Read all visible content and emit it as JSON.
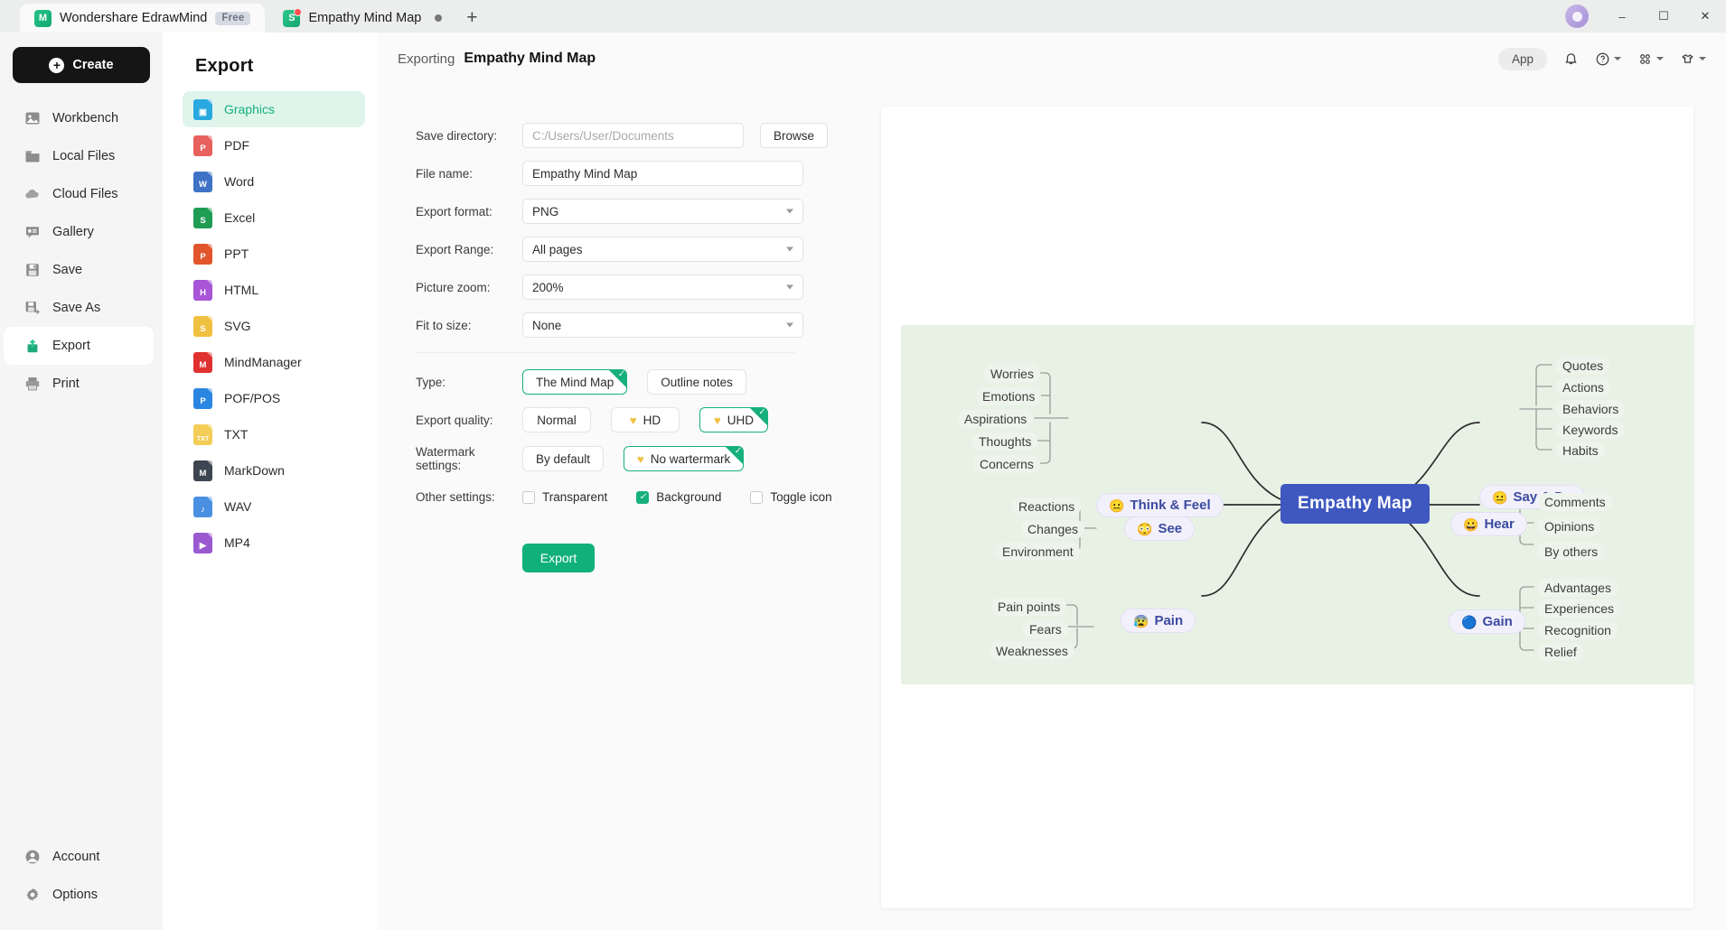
{
  "titlebar": {
    "app_tab": {
      "label": "Wondershare EdrawMind",
      "badge": "Free",
      "icon": "edrawmind-logo-icon"
    },
    "doc_tab": {
      "label": "Empathy Mind Map",
      "icon": "mindmap-doc-icon"
    },
    "new_tab_label": "+",
    "window": {
      "minimize": "–",
      "maximize": "☐",
      "close": "✕"
    }
  },
  "leftnav": {
    "create_label": "Create",
    "items": [
      {
        "label": "Workbench",
        "icon": "workbench-icon"
      },
      {
        "label": "Local Files",
        "icon": "folder-icon"
      },
      {
        "label": "Cloud Files",
        "icon": "cloud-icon"
      },
      {
        "label": "Gallery",
        "icon": "gallery-icon"
      },
      {
        "label": "Save",
        "icon": "save-icon"
      },
      {
        "label": "Save As",
        "icon": "save-as-icon"
      },
      {
        "label": "Export",
        "icon": "export-icon"
      },
      {
        "label": "Print",
        "icon": "print-icon"
      }
    ],
    "active": "Export",
    "bottom": [
      {
        "label": "Account",
        "icon": "account-icon"
      },
      {
        "label": "Options",
        "icon": "gear-icon"
      }
    ]
  },
  "format_panel": {
    "title": "Export",
    "active": "Graphics",
    "items": [
      {
        "label": "Graphics",
        "letter": "▣",
        "color": "#2aa9e0"
      },
      {
        "label": "PDF",
        "letter": "P",
        "color": "#e8615e"
      },
      {
        "label": "Word",
        "letter": "W",
        "color": "#3f72c4"
      },
      {
        "label": "Excel",
        "letter": "S",
        "color": "#1f9d55"
      },
      {
        "label": "PPT",
        "letter": "P",
        "color": "#e2552c"
      },
      {
        "label": "HTML",
        "letter": "H",
        "color": "#a855d8"
      },
      {
        "label": "SVG",
        "letter": "S",
        "color": "#f0c040"
      },
      {
        "label": "MindManager",
        "letter": "M",
        "color": "#e03131"
      },
      {
        "label": "POF/POS",
        "letter": "P",
        "color": "#2a86e0"
      },
      {
        "label": "TXT",
        "letter": "TXT",
        "color": "#f3cd58"
      },
      {
        "label": "MarkDown",
        "letter": "M",
        "color": "#3c4550"
      },
      {
        "label": "WAV",
        "letter": "♪",
        "color": "#4a90e2"
      },
      {
        "label": "MP4",
        "letter": "▶",
        "color": "#9b59d0"
      }
    ]
  },
  "topbar": {
    "breadcrumb_prefix": "Exporting",
    "document_title": "Empathy Mind Map",
    "app_pill": "App",
    "icons": [
      "bell-icon",
      "help-icon",
      "apps-grid-icon",
      "theme-shirt-icon"
    ]
  },
  "form": {
    "save_directory": {
      "label": "Save directory:",
      "placeholder": "C:/Users/User/Documents",
      "value": ""
    },
    "browse_label": "Browse",
    "file_name": {
      "label": "File name:",
      "value": "Empathy Mind Map"
    },
    "export_format": {
      "label": "Export format:",
      "value": "PNG"
    },
    "export_range": {
      "label": "Export Range:",
      "value": "All pages"
    },
    "picture_zoom": {
      "label": "Picture zoom:",
      "value": "200%"
    },
    "fit_to_size": {
      "label": "Fit to size:",
      "value": "None"
    },
    "type": {
      "label": "Type:",
      "options": [
        "The Mind Map",
        "Outline notes"
      ],
      "selected": "The Mind Map"
    },
    "export_quality": {
      "label": "Export quality:",
      "options": [
        "Normal",
        "HD",
        "UHD"
      ],
      "selected": "UHD"
    },
    "watermark": {
      "label": "Watermark settings:",
      "options": [
        "By default",
        "No wartermark"
      ],
      "selected": "No wartermark"
    },
    "other_settings": {
      "label": "Other settings:",
      "checkboxes": [
        {
          "label": "Transparent",
          "checked": false
        },
        {
          "label": "Background",
          "checked": true
        },
        {
          "label": "Toggle icon",
          "checked": false
        }
      ]
    },
    "export_button": "Export"
  },
  "mindmap": {
    "root": "Empathy Map",
    "branches": [
      {
        "title": "Think & Feel",
        "emoji": "😐",
        "side": "left",
        "children": [
          "Worries",
          "Emotions",
          "Aspirations",
          "Thoughts",
          "Concerns"
        ]
      },
      {
        "title": "Say & Do",
        "emoji": "😐",
        "side": "right",
        "children": [
          "Quotes",
          "Actions",
          "Behaviors",
          "Keywords",
          "Habits"
        ]
      },
      {
        "title": "See",
        "emoji": "😳",
        "side": "left",
        "children": [
          "Reactions",
          "Changes",
          "Environment"
        ]
      },
      {
        "title": "Hear",
        "emoji": "😀",
        "side": "right",
        "children": [
          "Comments",
          "Opinions",
          "By others"
        ]
      },
      {
        "title": "Pain",
        "emoji": "😰",
        "side": "left",
        "children": [
          "Pain points",
          "Fears",
          "Weaknesses"
        ]
      },
      {
        "title": "Gain",
        "emoji": "🔵",
        "side": "right",
        "children": [
          "Advantages",
          "Experiences",
          "Recognition",
          "Relief"
        ]
      }
    ]
  },
  "colors": {
    "accent_green": "#16b07b",
    "root_blue": "#3f58c0",
    "canvas_green": "#e8f2e4",
    "branch_text": "#3b4aa0"
  }
}
